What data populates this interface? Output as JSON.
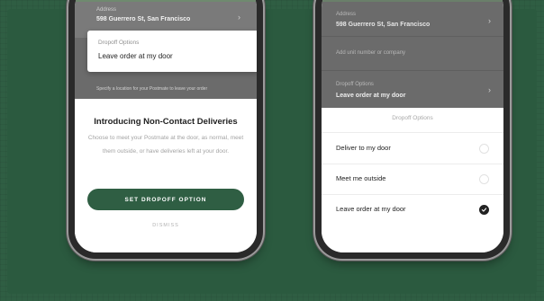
{
  "left_phone": {
    "address_label": "Address",
    "address_value": "598 Guerrero St, San Francisco",
    "dropoff_label": "Dropoff Options",
    "dropoff_value": "Leave order at my door",
    "hint": "Specify a location for your Postmate to leave your order",
    "sheet": {
      "title": "Introducing Non-Contact Deliveries",
      "description": "Choose to meet your Postmate at the door, as normal, meet them outside, or have deliveries left at your door.",
      "cta": "SET DROPOFF OPTION",
      "dismiss": "DISMISS"
    }
  },
  "right_phone": {
    "address_label": "Address",
    "address_value": "598 Guerrero St, San Francisco",
    "unit_placeholder": "Add unit number or company",
    "dropoff_label": "Dropoff Options",
    "dropoff_value": "Leave order at my door",
    "sheet": {
      "title": "Dropoff Options",
      "options": [
        {
          "label": "Deliver to my door",
          "selected": false
        },
        {
          "label": "Meet me outside",
          "selected": false
        },
        {
          "label": "Leave order at my door",
          "selected": true
        }
      ]
    }
  },
  "colors": {
    "brand_green": "#2f5e43",
    "background": "#2f5e43",
    "overlay_gray": "#6b6b6b"
  }
}
